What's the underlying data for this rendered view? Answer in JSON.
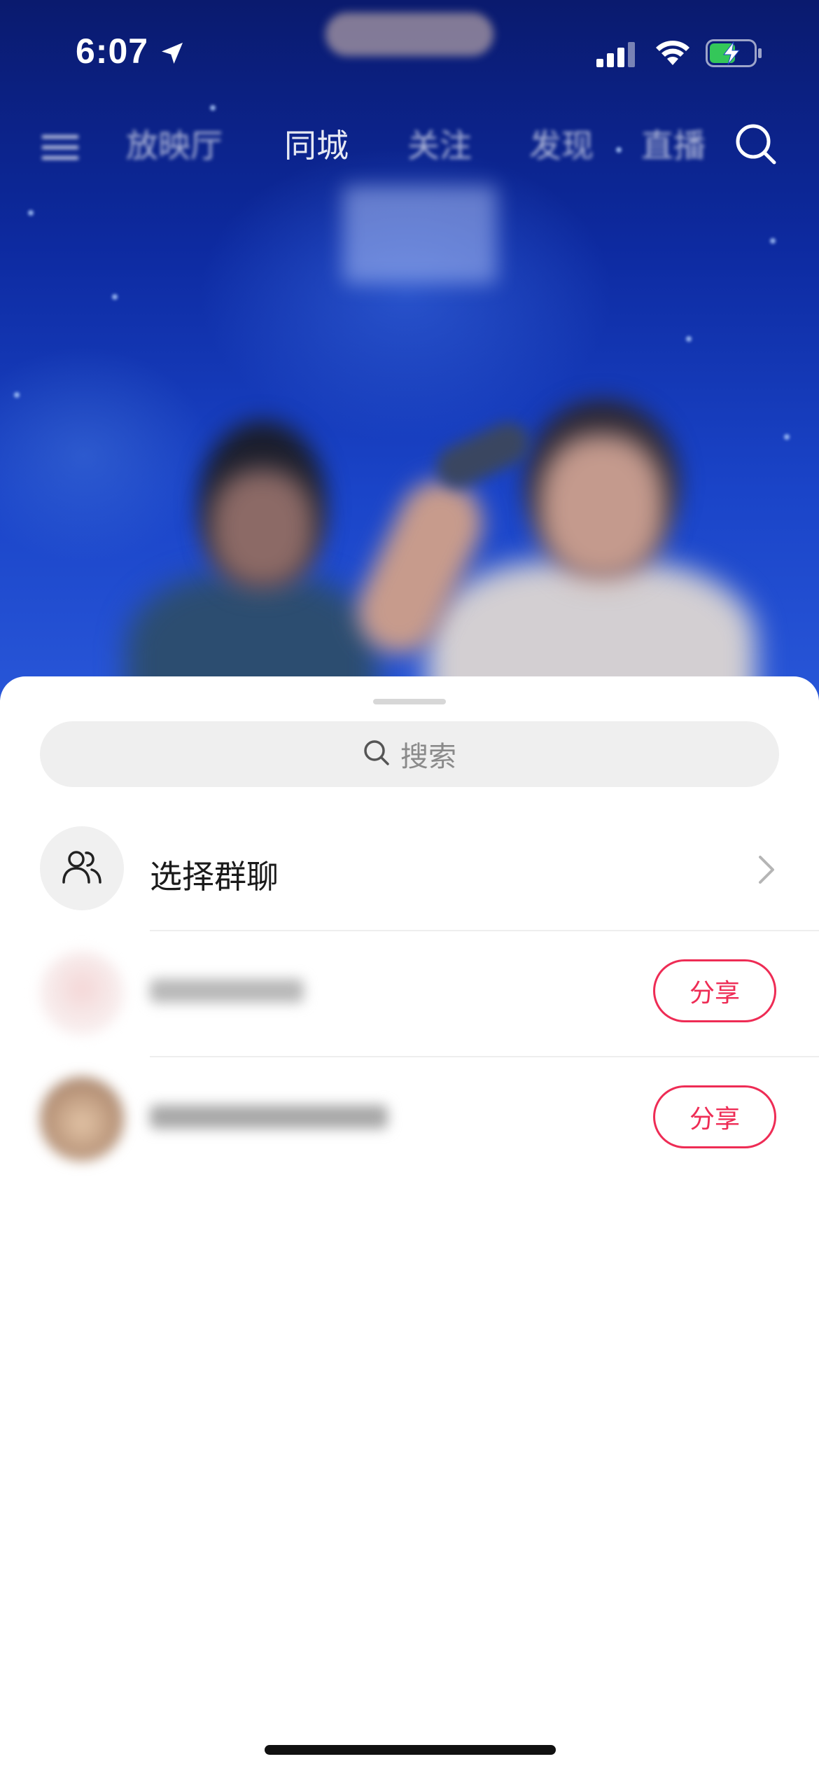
{
  "status_bar": {
    "time": "6:07",
    "icons": [
      "location-arrow-icon",
      "signal-icon",
      "wifi-icon",
      "battery-charging-icon"
    ],
    "battery_color": "#34c759"
  },
  "top_nav": {
    "items": [
      "放映厅",
      "同城",
      "关注",
      "发现",
      "直播"
    ],
    "icons": [
      "menu-icon",
      "search-icon"
    ]
  },
  "share_sheet": {
    "search_placeholder": "搜索",
    "group_chat_label": "选择群聊",
    "contacts": [
      {
        "name": "",
        "share_label": "分享"
      },
      {
        "name": "",
        "share_label": "分享"
      }
    ],
    "accent_color": "#ee2c55"
  }
}
